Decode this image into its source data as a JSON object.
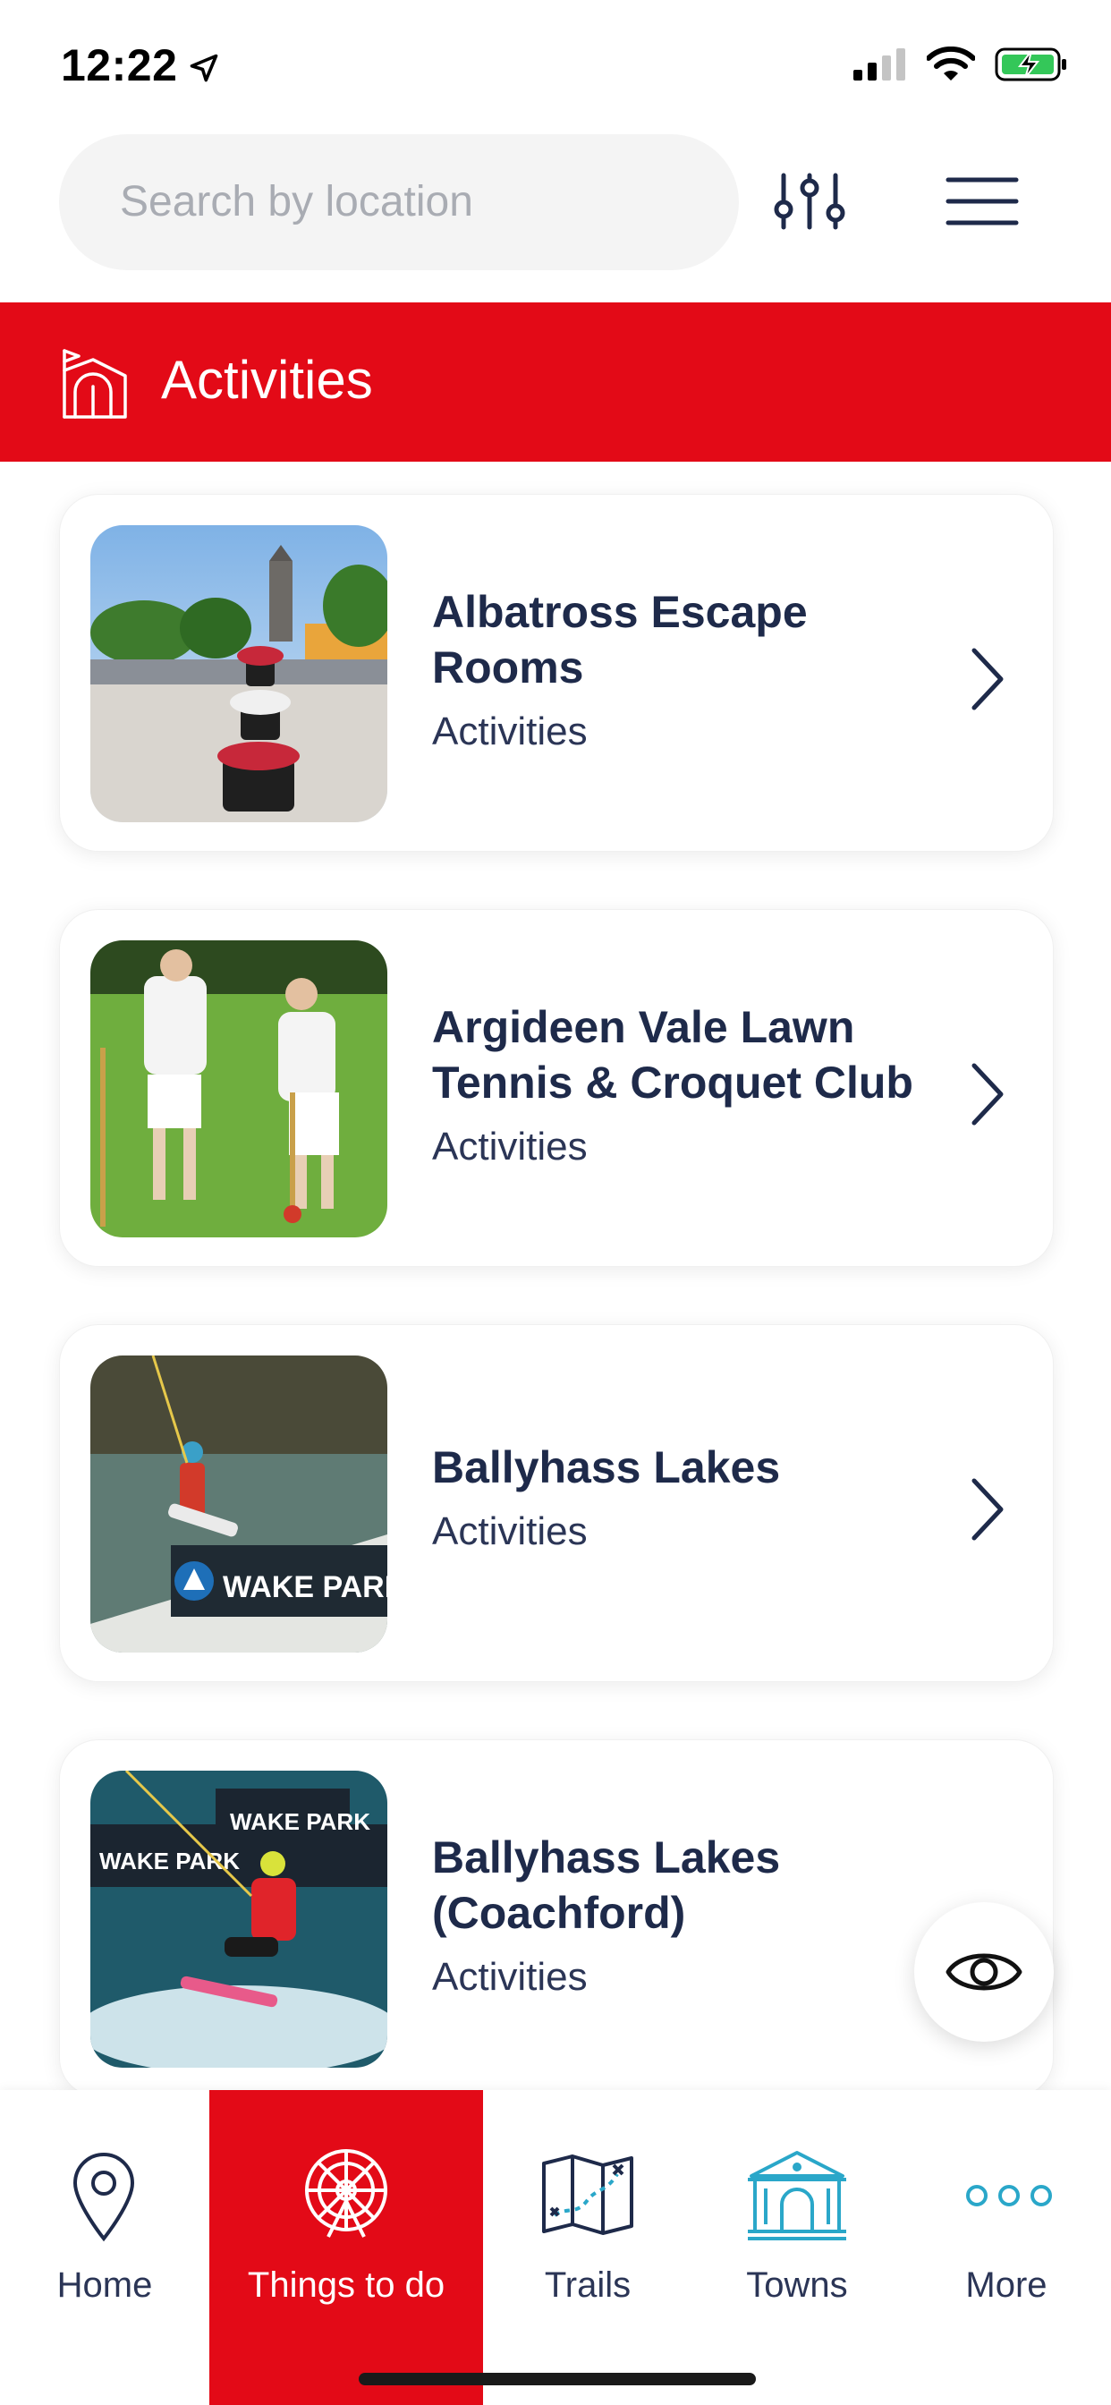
{
  "status_bar": {
    "time": "12:22"
  },
  "header": {
    "search_placeholder": "Search by location",
    "filter_icon": "sliders-icon",
    "menu_icon": "hamburger-menu-icon"
  },
  "section": {
    "title": "Activities",
    "icon": "activities-tent-icon"
  },
  "cards": [
    {
      "title": "Albatross Escape Rooms",
      "category": "Activities",
      "image": "town-square-planter-photo"
    },
    {
      "title": "Argideen Vale Lawn Tennis & Croquet Club",
      "category": "Activities",
      "image": "croquet-players-photo"
    },
    {
      "title": "Ballyhass Lakes",
      "category": "Activities",
      "image": "wakeboard-ramp-photo"
    },
    {
      "title": "Ballyhass Lakes (Coachford)",
      "category": "Activities",
      "image": "wakeboarder-spray-photo"
    }
  ],
  "fab": {
    "icon": "eye-icon"
  },
  "nav": {
    "items": [
      {
        "label": "Home",
        "icon": "map-pin-icon",
        "active": false
      },
      {
        "label": "Things to do",
        "icon": "ferris-wheel-icon",
        "active": true
      },
      {
        "label": "Trails",
        "icon": "trail-map-icon",
        "active": false
      },
      {
        "label": "Towns",
        "icon": "town-hall-icon",
        "active": false
      },
      {
        "label": "More",
        "icon": "more-dots-icon",
        "active": false
      }
    ]
  },
  "colors": {
    "brand_red": "#e30a17",
    "navy": "#1e2a4a",
    "teal": "#2aa7c9",
    "battery_green": "#34c759"
  }
}
